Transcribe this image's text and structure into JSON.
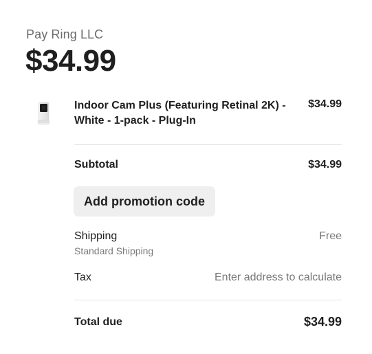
{
  "merchant": {
    "name": "Pay Ring LLC",
    "amount": "$34.99"
  },
  "line_item": {
    "image_icon": "indoor-camera-icon",
    "name": "Indoor Cam Plus (Featuring Retinal 2K) - White - 1-pack - Plug-In",
    "price": "$34.99"
  },
  "subtotal": {
    "label": "Subtotal",
    "value": "$34.99"
  },
  "promo": {
    "label": "Add promotion code"
  },
  "shipping": {
    "label": "Shipping",
    "sublabel": "Standard Shipping",
    "value": "Free"
  },
  "tax": {
    "label": "Tax",
    "value": "Enter address to calculate"
  },
  "total_due": {
    "label": "Total due",
    "value": "$34.99"
  }
}
